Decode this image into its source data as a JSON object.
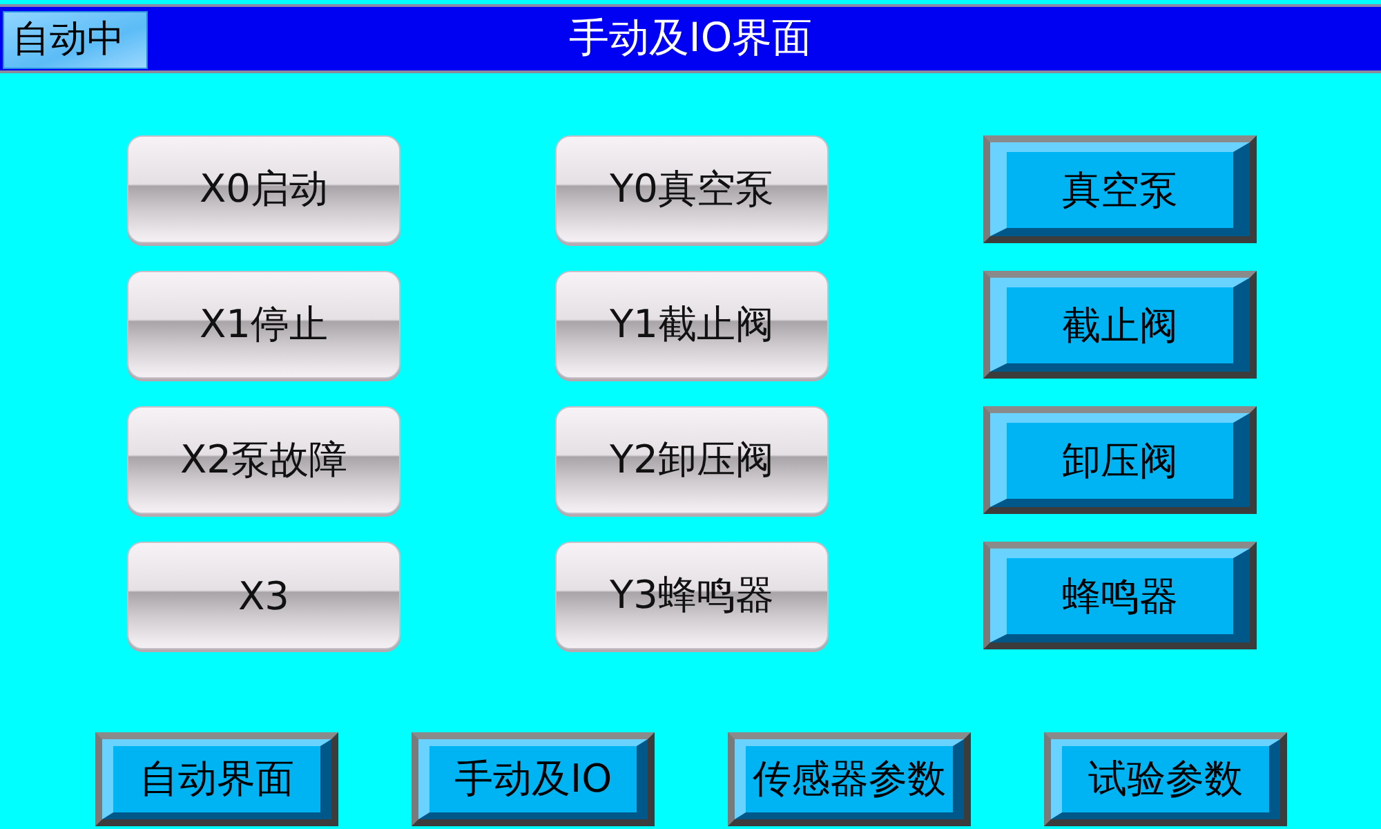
{
  "header": {
    "status": "自动中",
    "title": "手动及IO界面"
  },
  "inputs": [
    {
      "label": "X0启动"
    },
    {
      "label": "X1停止"
    },
    {
      "label": "X2泵故障"
    },
    {
      "label": "X3"
    }
  ],
  "outputs": [
    {
      "label": "Y0真空泵"
    },
    {
      "label": "Y1截止阀"
    },
    {
      "label": "Y2卸压阀"
    },
    {
      "label": "Y3蜂鸣器"
    }
  ],
  "output_buttons": [
    {
      "label": "真空泵"
    },
    {
      "label": "截止阀"
    },
    {
      "label": "卸压阀"
    },
    {
      "label": "蜂鸣器"
    }
  ],
  "nav_buttons": [
    {
      "label": "自动界面"
    },
    {
      "label": "手动及IO"
    },
    {
      "label": "传感器参数"
    },
    {
      "label": "试验参数"
    }
  ]
}
